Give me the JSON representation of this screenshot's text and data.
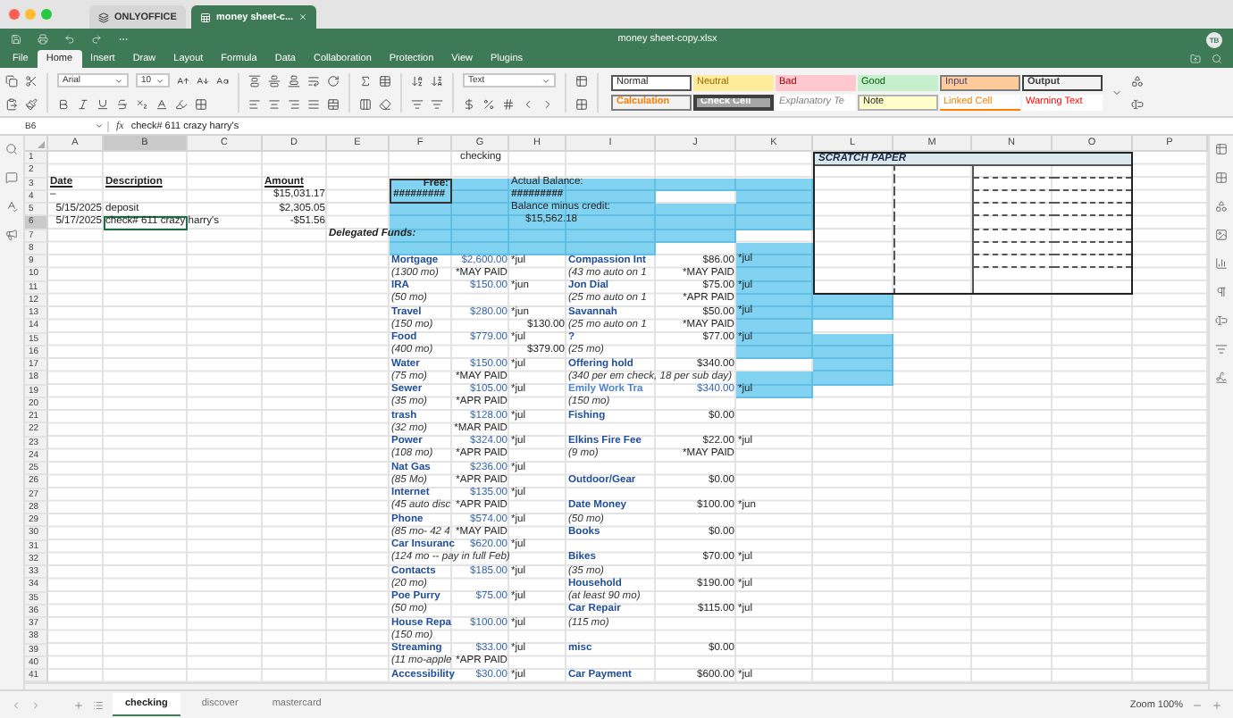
{
  "browser_tabs": [
    {
      "label": "ONLYOFFICE",
      "selected": false
    },
    {
      "label": "money sheet-c...",
      "selected": true
    }
  ],
  "title": "money sheet-copy.xlsx",
  "user_initials": "TB",
  "menu": [
    {
      "label": "File",
      "selected": false
    },
    {
      "label": "Home",
      "selected": true
    },
    {
      "label": "Insert",
      "selected": false
    },
    {
      "label": "Draw",
      "selected": false
    },
    {
      "label": "Layout",
      "selected": false
    },
    {
      "label": "Formula",
      "selected": false
    },
    {
      "label": "Data",
      "selected": false
    },
    {
      "label": "Collaboration",
      "selected": false
    },
    {
      "label": "Protection",
      "selected": false
    },
    {
      "label": "View",
      "selected": false
    },
    {
      "label": "Plugins",
      "selected": false
    }
  ],
  "toolbar": {
    "font": "Arial",
    "font_size": "10",
    "number_format": "Text",
    "styles": [
      {
        "label": "Normal",
        "kind": "normal"
      },
      {
        "label": "Neutral",
        "kind": "neutral"
      },
      {
        "label": "Bad",
        "kind": "bad"
      },
      {
        "label": "Good",
        "kind": "good"
      },
      {
        "label": "Input",
        "kind": "input"
      },
      {
        "label": "Output",
        "kind": "output"
      },
      {
        "label": "Calculation",
        "kind": "calculation"
      },
      {
        "label": "Check Cell",
        "kind": "check"
      },
      {
        "label": "Explanatory Te",
        "kind": "explanatory"
      },
      {
        "label": "Note",
        "kind": "note"
      },
      {
        "label": "Linked Cell",
        "kind": "linked"
      },
      {
        "label": "Warning Text",
        "kind": "warning"
      }
    ]
  },
  "formula_bar": {
    "cell": "B6",
    "function_label": "fx",
    "value": "check# 611 crazy harry's"
  },
  "sheet": {
    "columns": [
      {
        "label": "A",
        "selected": false
      },
      {
        "label": "B",
        "selected": true
      },
      {
        "label": "C",
        "selected": false
      },
      {
        "label": "D",
        "selected": false
      },
      {
        "label": "E",
        "selected": false
      },
      {
        "label": "F",
        "selected": false
      },
      {
        "label": "G",
        "selected": false
      },
      {
        "label": "H",
        "selected": false
      },
      {
        "label": "I",
        "selected": false
      },
      {
        "label": "J",
        "selected": false
      },
      {
        "label": "K",
        "selected": false
      },
      {
        "label": "L",
        "selected": false
      },
      {
        "label": "M",
        "selected": false
      },
      {
        "label": "N",
        "selected": false
      },
      {
        "label": "O",
        "selected": false
      },
      {
        "label": "P",
        "selected": false
      }
    ],
    "scratch_paper": {
      "title": "SCRATCH PAPER"
    },
    "rows": [
      {
        "number": "1",
        "selected": false,
        "cells": [
          {
            "fill": false
          },
          {
            "fill": false
          },
          {
            "fill": false
          },
          {
            "fill": false
          },
          {
            "fill": false
          },
          {
            "fill": false
          },
          {
            "fill": false,
            "text": "checking",
            "kind": "title"
          }
        ]
      },
      {
        "number": "2",
        "selected": false,
        "cells": []
      },
      {
        "number": "3",
        "selected": false,
        "cells": [
          {
            "fill": false,
            "text": "Date",
            "kind": "header"
          },
          {
            "fill": false,
            "text": "Description",
            "kind": "header"
          },
          {
            "fill": false
          },
          {
            "fill": false,
            "text": "Amount",
            "kind": "header"
          },
          {
            "fill": false
          },
          {
            "fill": true,
            "text": "Free:",
            "kind": "boxed_label"
          },
          {
            "fill": true
          },
          {
            "fill": true,
            "text": "Actual Balance:",
            "kind": "text"
          },
          {
            "fill": true
          },
          {
            "fill": true
          },
          {
            "fill": true
          }
        ]
      },
      {
        "number": "4",
        "selected": false,
        "cells": [
          {
            "fill": false,
            "text": "–",
            "kind": "text"
          },
          {
            "fill": false
          },
          {
            "fill": false
          },
          {
            "fill": false,
            "text": "$15,031.17",
            "kind": "amount"
          },
          {
            "fill": false
          },
          {
            "fill": true,
            "text": "#########",
            "kind": "boxed_hash"
          },
          {
            "fill": true
          },
          {
            "fill": true,
            "text": "#########",
            "kind": "hash"
          },
          {
            "fill": true
          },
          {
            "fill": false
          },
          {
            "fill": true
          }
        ]
      },
      {
        "number": "5",
        "selected": false,
        "cells": [
          {
            "fill": false,
            "text": "5/15/2025",
            "kind": "date"
          },
          {
            "fill": false,
            "text": "deposit",
            "kind": "text"
          },
          {
            "fill": false
          },
          {
            "fill": false,
            "text": "$2,305.05",
            "kind": "amount"
          },
          {
            "fill": false
          },
          {
            "fill": true
          },
          {
            "fill": true
          },
          {
            "fill": true,
            "text": "Balance minus credit:",
            "kind": "text"
          },
          {
            "fill": true
          },
          {
            "fill": true
          },
          {
            "fill": true
          }
        ]
      },
      {
        "number": "6",
        "selected": true,
        "cells": [
          {
            "fill": false,
            "text": "5/17/2025",
            "kind": "date"
          },
          {
            "fill": false,
            "text": "check# 611 crazy harry's",
            "kind": "text"
          },
          {
            "fill": false
          },
          {
            "fill": false,
            "text": "-$51.56",
            "kind": "amount"
          },
          {
            "fill": false
          },
          {
            "fill": true
          },
          {
            "fill": true
          },
          {
            "fill": true,
            "text": "$15,562.18",
            "kind": "indent"
          },
          {
            "fill": true
          },
          {
            "fill": true
          },
          {
            "fill": true
          }
        ]
      },
      {
        "number": "7",
        "selected": false,
        "cells": [
          {
            "fill": false
          },
          {
            "fill": false
          },
          {
            "fill": false
          },
          {
            "fill": false
          },
          {
            "fill": false,
            "text": "Delegated Funds:",
            "kind": "section"
          },
          {
            "fill": true
          },
          {
            "fill": true
          },
          {
            "fill": true
          },
          {
            "fill": true
          },
          {
            "fill": true
          },
          {
            "fill": false
          }
        ]
      },
      {
        "number": "8",
        "selected": false,
        "cells": [
          {
            "fill": false
          },
          {
            "fill": false
          },
          {
            "fill": false
          },
          {
            "fill": false
          },
          {
            "fill": false
          },
          {
            "fill": true
          },
          {
            "fill": true
          },
          {
            "fill": true
          },
          {
            "fill": true
          },
          {
            "fill": false
          },
          {
            "fill": true
          }
        ]
      },
      {
        "number": "9",
        "selected": false,
        "cells": [
          {
            "fill": false
          },
          {
            "fill": false
          },
          {
            "fill": false
          },
          {
            "fill": false
          },
          {
            "fill": false
          },
          {
            "fill": false,
            "text": "Mortgage",
            "kind": "name"
          },
          {
            "fill": false,
            "text": "$2,600.00",
            "kind": "money"
          },
          {
            "fill": false,
            "text": "*jul",
            "kind": "tag"
          },
          {
            "fill": false,
            "text": "Compassion Int",
            "kind": "name"
          },
          {
            "fill": false,
            "text": "$86.00",
            "kind": "amount"
          },
          {
            "fill": true,
            "text": "*jul",
            "kind": "tag"
          }
        ]
      },
      {
        "number": "10",
        "selected": false,
        "cells": [
          {
            "fill": false
          },
          {
            "fill": false
          },
          {
            "fill": false
          },
          {
            "fill": false
          },
          {
            "fill": false
          },
          {
            "fill": false,
            "text": "(1300 mo)",
            "kind": "note"
          },
          {
            "fill": false,
            "text": "*MAY PAID",
            "kind": "status"
          },
          {
            "fill": false
          },
          {
            "fill": false,
            "text": "(43 mo auto on 1",
            "kind": "note"
          },
          {
            "fill": false,
            "text": "*MAY PAID",
            "kind": "status"
          },
          {
            "fill": true
          }
        ]
      },
      {
        "number": "11",
        "selected": false,
        "cells": [
          {
            "fill": false
          },
          {
            "fill": false
          },
          {
            "fill": false
          },
          {
            "fill": false
          },
          {
            "fill": false
          },
          {
            "fill": false,
            "text": "IRA",
            "kind": "name"
          },
          {
            "fill": false,
            "text": "$150.00",
            "kind": "money"
          },
          {
            "fill": false,
            "text": "*jun",
            "kind": "tag"
          },
          {
            "fill": false,
            "text": "Jon Dial",
            "kind": "name"
          },
          {
            "fill": false,
            "text": "$75.00",
            "kind": "amount"
          },
          {
            "fill": true,
            "text": "*jul",
            "kind": "tag"
          }
        ]
      },
      {
        "number": "12",
        "selected": false,
        "cells": [
          {
            "fill": false
          },
          {
            "fill": false
          },
          {
            "fill": false
          },
          {
            "fill": false
          },
          {
            "fill": false
          },
          {
            "fill": false,
            "text": "(50 mo)",
            "kind": "note"
          },
          {
            "fill": false
          },
          {
            "fill": false
          },
          {
            "fill": false,
            "text": "(25 mo auto on 1",
            "kind": "note"
          },
          {
            "fill": false,
            "text": "*APR PAID",
            "kind": "status"
          },
          {
            "fill": true
          },
          {
            "fill": true
          }
        ]
      },
      {
        "number": "13",
        "selected": false,
        "cells": [
          {
            "fill": false
          },
          {
            "fill": false
          },
          {
            "fill": false
          },
          {
            "fill": false
          },
          {
            "fill": false
          },
          {
            "fill": false,
            "text": "Travel",
            "kind": "name"
          },
          {
            "fill": false,
            "text": "$280.00",
            "kind": "money"
          },
          {
            "fill": false,
            "text": "*jun",
            "kind": "tag"
          },
          {
            "fill": false,
            "text": "Savannah",
            "kind": "name"
          },
          {
            "fill": false,
            "text": "$50.00",
            "kind": "amount"
          },
          {
            "fill": true,
            "text": "*jul",
            "kind": "tag"
          },
          {
            "fill": true
          }
        ]
      },
      {
        "number": "14",
        "selected": false,
        "cells": [
          {
            "fill": false
          },
          {
            "fill": false
          },
          {
            "fill": false
          },
          {
            "fill": false
          },
          {
            "fill": false
          },
          {
            "fill": false,
            "text": "(150 mo)",
            "kind": "note"
          },
          {
            "fill": false
          },
          {
            "fill": false,
            "text": "$130.00",
            "kind": "amount"
          },
          {
            "fill": false,
            "text": "(25 mo auto on 1",
            "kind": "note"
          },
          {
            "fill": false,
            "text": "*MAY PAID",
            "kind": "status"
          },
          {
            "fill": true
          }
        ]
      },
      {
        "number": "15",
        "selected": false,
        "cells": [
          {
            "fill": false
          },
          {
            "fill": false
          },
          {
            "fill": false
          },
          {
            "fill": false
          },
          {
            "fill": false
          },
          {
            "fill": false,
            "text": "Food",
            "kind": "name"
          },
          {
            "fill": false,
            "text": "$779.00",
            "kind": "money"
          },
          {
            "fill": false,
            "text": "*jul",
            "kind": "tag"
          },
          {
            "fill": false,
            "text": "?",
            "kind": "name"
          },
          {
            "fill": false,
            "text": "$77.00",
            "kind": "amount"
          },
          {
            "fill": true,
            "text": "*jul",
            "kind": "tag"
          },
          {
            "fill": true
          }
        ]
      },
      {
        "number": "16",
        "selected": false,
        "cells": [
          {
            "fill": false
          },
          {
            "fill": false
          },
          {
            "fill": false
          },
          {
            "fill": false
          },
          {
            "fill": false
          },
          {
            "fill": false,
            "text": "(400 mo)",
            "kind": "note"
          },
          {
            "fill": false
          },
          {
            "fill": false,
            "text": "$379.00",
            "kind": "amount"
          },
          {
            "fill": false,
            "text": "(25 mo)",
            "kind": "note"
          },
          {
            "fill": false
          },
          {
            "fill": true
          },
          {
            "fill": true
          }
        ]
      },
      {
        "number": "17",
        "selected": false,
        "cells": [
          {
            "fill": false
          },
          {
            "fill": false
          },
          {
            "fill": false
          },
          {
            "fill": false
          },
          {
            "fill": false
          },
          {
            "fill": false,
            "text": "Water",
            "kind": "name"
          },
          {
            "fill": false,
            "text": "$150.00",
            "kind": "money"
          },
          {
            "fill": false,
            "text": "*jul",
            "kind": "tag"
          },
          {
            "fill": false,
            "text": "Offering hold",
            "kind": "name"
          },
          {
            "fill": false,
            "text": "$340.00",
            "kind": "amount"
          },
          {
            "fill": false
          },
          {
            "fill": true
          }
        ]
      },
      {
        "number": "18",
        "selected": false,
        "cells": [
          {
            "fill": false
          },
          {
            "fill": false
          },
          {
            "fill": false
          },
          {
            "fill": false
          },
          {
            "fill": false
          },
          {
            "fill": false,
            "text": "(75 mo)",
            "kind": "note"
          },
          {
            "fill": false,
            "text": "*MAY PAID",
            "kind": "status"
          },
          {
            "fill": false
          },
          {
            "fill": false,
            "text": "(340 per em check, 18 per sub day)",
            "kind": "note"
          },
          {
            "fill": false
          },
          {
            "fill": true
          },
          {
            "fill": true
          }
        ]
      },
      {
        "number": "19",
        "selected": false,
        "cells": [
          {
            "fill": false
          },
          {
            "fill": false
          },
          {
            "fill": false
          },
          {
            "fill": false
          },
          {
            "fill": false
          },
          {
            "fill": false,
            "text": "Sewer",
            "kind": "name"
          },
          {
            "fill": false,
            "text": "$105.00",
            "kind": "money"
          },
          {
            "fill": false,
            "text": "*jul",
            "kind": "tag"
          },
          {
            "fill": false,
            "text": "Emily Work Tra",
            "kind": "name_alt"
          },
          {
            "fill": false,
            "text": "$340.00",
            "kind": "money"
          },
          {
            "fill": true,
            "text": "*jul",
            "kind": "tag"
          }
        ]
      },
      {
        "number": "20",
        "selected": false,
        "cells": [
          {
            "fill": false
          },
          {
            "fill": false
          },
          {
            "fill": false
          },
          {
            "fill": false
          },
          {
            "fill": false
          },
          {
            "fill": false,
            "text": "(35 mo)",
            "kind": "note"
          },
          {
            "fill": false,
            "text": "*APR PAID",
            "kind": "status"
          },
          {
            "fill": false
          },
          {
            "fill": false,
            "text": "(150 mo)",
            "kind": "note"
          }
        ]
      },
      {
        "number": "21",
        "selected": false,
        "cells": [
          {
            "fill": false
          },
          {
            "fill": false
          },
          {
            "fill": false
          },
          {
            "fill": false
          },
          {
            "fill": false
          },
          {
            "fill": false,
            "text": "trash",
            "kind": "name"
          },
          {
            "fill": false,
            "text": "$128.00",
            "kind": "money"
          },
          {
            "fill": false,
            "text": "*jul",
            "kind": "tag"
          },
          {
            "fill": false,
            "text": "Fishing",
            "kind": "name"
          },
          {
            "fill": false,
            "text": "$0.00",
            "kind": "amount"
          }
        ]
      },
      {
        "number": "22",
        "selected": false,
        "cells": [
          {
            "fill": false
          },
          {
            "fill": false
          },
          {
            "fill": false
          },
          {
            "fill": false
          },
          {
            "fill": false
          },
          {
            "fill": false,
            "text": "(32 mo)",
            "kind": "note"
          },
          {
            "fill": false,
            "text": "*MAR PAID",
            "kind": "status"
          }
        ]
      },
      {
        "number": "23",
        "selected": false,
        "cells": [
          {
            "fill": false
          },
          {
            "fill": false
          },
          {
            "fill": false
          },
          {
            "fill": false
          },
          {
            "fill": false
          },
          {
            "fill": false,
            "text": "Power",
            "kind": "name"
          },
          {
            "fill": false,
            "text": "$324.00",
            "kind": "money"
          },
          {
            "fill": false,
            "text": "*jul",
            "kind": "tag"
          },
          {
            "fill": false,
            "text": "Elkins Fire Fee",
            "kind": "name"
          },
          {
            "fill": false,
            "text": "$22.00",
            "kind": "amount"
          },
          {
            "fill": false,
            "text": "*jul",
            "kind": "tag"
          }
        ]
      },
      {
        "number": "24",
        "selected": false,
        "cells": [
          {
            "fill": false
          },
          {
            "fill": false
          },
          {
            "fill": false
          },
          {
            "fill": false
          },
          {
            "fill": false
          },
          {
            "fill": false,
            "text": "(108 mo)",
            "kind": "note"
          },
          {
            "fill": false,
            "text": "*APR PAID",
            "kind": "status"
          },
          {
            "fill": false
          },
          {
            "fill": false,
            "text": "(9 mo)",
            "kind": "note"
          },
          {
            "fill": false,
            "text": "*MAY PAID",
            "kind": "status"
          }
        ]
      },
      {
        "number": "25",
        "selected": false,
        "cells": [
          {
            "fill": false
          },
          {
            "fill": false
          },
          {
            "fill": false
          },
          {
            "fill": false
          },
          {
            "fill": false
          },
          {
            "fill": false,
            "text": "Nat Gas",
            "kind": "name"
          },
          {
            "fill": false,
            "text": "$236.00",
            "kind": "money"
          },
          {
            "fill": false,
            "text": "*jul",
            "kind": "tag"
          }
        ]
      },
      {
        "number": "26",
        "selected": false,
        "cells": [
          {
            "fill": false
          },
          {
            "fill": false
          },
          {
            "fill": false
          },
          {
            "fill": false
          },
          {
            "fill": false
          },
          {
            "fill": false,
            "text": "(85 Mo)",
            "kind": "note"
          },
          {
            "fill": false,
            "text": "*APR PAID",
            "kind": "status"
          },
          {
            "fill": false
          },
          {
            "fill": false,
            "text": "Outdoor/Gear",
            "kind": "name"
          },
          {
            "fill": false,
            "text": "$0.00",
            "kind": "amount"
          }
        ]
      },
      {
        "number": "27",
        "selected": false,
        "cells": [
          {
            "fill": false
          },
          {
            "fill": false
          },
          {
            "fill": false
          },
          {
            "fill": false
          },
          {
            "fill": false
          },
          {
            "fill": false,
            "text": "Internet",
            "kind": "name"
          },
          {
            "fill": false,
            "text": "$135.00",
            "kind": "money"
          },
          {
            "fill": false,
            "text": "*jul",
            "kind": "tag"
          }
        ]
      },
      {
        "number": "28",
        "selected": false,
        "cells": [
          {
            "fill": false
          },
          {
            "fill": false
          },
          {
            "fill": false
          },
          {
            "fill": false
          },
          {
            "fill": false
          },
          {
            "fill": false,
            "text": "(45 auto disc",
            "kind": "note"
          },
          {
            "fill": false,
            "text": "*APR PAID",
            "kind": "status"
          },
          {
            "fill": false
          },
          {
            "fill": false,
            "text": "Date Money",
            "kind": "name"
          },
          {
            "fill": false,
            "text": "$100.00",
            "kind": "amount"
          },
          {
            "fill": false,
            "text": "*jun",
            "kind": "tag"
          }
        ]
      },
      {
        "number": "29",
        "selected": false,
        "cells": [
          {
            "fill": false
          },
          {
            "fill": false
          },
          {
            "fill": false
          },
          {
            "fill": false
          },
          {
            "fill": false
          },
          {
            "fill": false,
            "text": "Phone",
            "kind": "name"
          },
          {
            "fill": false,
            "text": "$574.00",
            "kind": "money"
          },
          {
            "fill": false,
            "text": "*jul",
            "kind": "tag"
          },
          {
            "fill": false,
            "text": "(50 mo)",
            "kind": "note"
          }
        ]
      },
      {
        "number": "30",
        "selected": false,
        "cells": [
          {
            "fill": false
          },
          {
            "fill": false
          },
          {
            "fill": false
          },
          {
            "fill": false
          },
          {
            "fill": false
          },
          {
            "fill": false,
            "text": "(85 mo- 42 4",
            "kind": "note"
          },
          {
            "fill": false,
            "text": "*MAY PAID",
            "kind": "status"
          },
          {
            "fill": false
          },
          {
            "fill": false,
            "text": "Books",
            "kind": "name"
          },
          {
            "fill": false,
            "text": "$0.00",
            "kind": "amount"
          }
        ]
      },
      {
        "number": "31",
        "selected": false,
        "cells": [
          {
            "fill": false
          },
          {
            "fill": false
          },
          {
            "fill": false
          },
          {
            "fill": false
          },
          {
            "fill": false
          },
          {
            "fill": false,
            "text": "Car Insuranc",
            "kind": "name"
          },
          {
            "fill": false,
            "text": "$620.00",
            "kind": "money"
          },
          {
            "fill": false,
            "text": "*jul",
            "kind": "tag"
          }
        ]
      },
      {
        "number": "32",
        "selected": false,
        "cells": [
          {
            "fill": false
          },
          {
            "fill": false
          },
          {
            "fill": false
          },
          {
            "fill": false
          },
          {
            "fill": false
          },
          {
            "fill": false,
            "text": "(124 mo -- pay in full Feb)",
            "kind": "note"
          },
          {
            "fill": false
          },
          {
            "fill": false
          },
          {
            "fill": false,
            "text": "Bikes",
            "kind": "name"
          },
          {
            "fill": false,
            "text": "$70.00",
            "kind": "amount"
          },
          {
            "fill": false,
            "text": "*jul",
            "kind": "tag"
          }
        ]
      },
      {
        "number": "33",
        "selected": false,
        "cells": [
          {
            "fill": false
          },
          {
            "fill": false
          },
          {
            "fill": false
          },
          {
            "fill": false
          },
          {
            "fill": false
          },
          {
            "fill": false,
            "text": "Contacts",
            "kind": "name"
          },
          {
            "fill": false,
            "text": "$185.00",
            "kind": "money"
          },
          {
            "fill": false,
            "text": "*jul",
            "kind": "tag"
          },
          {
            "fill": false,
            "text": "(35 mo)",
            "kind": "note"
          }
        ]
      },
      {
        "number": "34",
        "selected": false,
        "cells": [
          {
            "fill": false
          },
          {
            "fill": false
          },
          {
            "fill": false
          },
          {
            "fill": false
          },
          {
            "fill": false
          },
          {
            "fill": false,
            "text": "(20 mo)",
            "kind": "note"
          },
          {
            "fill": false
          },
          {
            "fill": false
          },
          {
            "fill": false,
            "text": "Household",
            "kind": "name"
          },
          {
            "fill": false,
            "text": "$190.00",
            "kind": "amount"
          },
          {
            "fill": false,
            "text": "*jul",
            "kind": "tag"
          }
        ]
      },
      {
        "number": "35",
        "selected": false,
        "cells": [
          {
            "fill": false
          },
          {
            "fill": false
          },
          {
            "fill": false
          },
          {
            "fill": false
          },
          {
            "fill": false
          },
          {
            "fill": false,
            "text": "Poe Purry",
            "kind": "name"
          },
          {
            "fill": false,
            "text": "$75.00",
            "kind": "money"
          },
          {
            "fill": false,
            "text": "*jul",
            "kind": "tag"
          },
          {
            "fill": false,
            "text": "(at least 90 mo)",
            "kind": "note"
          }
        ]
      },
      {
        "number": "36",
        "selected": false,
        "cells": [
          {
            "fill": false
          },
          {
            "fill": false
          },
          {
            "fill": false
          },
          {
            "fill": false
          },
          {
            "fill": false
          },
          {
            "fill": false,
            "text": "(50 mo)",
            "kind": "note"
          },
          {
            "fill": false
          },
          {
            "fill": false
          },
          {
            "fill": false,
            "text": "Car Repair",
            "kind": "name"
          },
          {
            "fill": false,
            "text": "$115.00",
            "kind": "amount"
          },
          {
            "fill": false,
            "text": "*jul",
            "kind": "tag"
          }
        ]
      },
      {
        "number": "37",
        "selected": false,
        "cells": [
          {
            "fill": false
          },
          {
            "fill": false
          },
          {
            "fill": false
          },
          {
            "fill": false
          },
          {
            "fill": false
          },
          {
            "fill": false,
            "text": "House Repa",
            "kind": "name"
          },
          {
            "fill": false,
            "text": "$100.00",
            "kind": "money"
          },
          {
            "fill": false,
            "text": "*jul",
            "kind": "tag"
          },
          {
            "fill": false,
            "text": "(115 mo)",
            "kind": "note"
          }
        ]
      },
      {
        "number": "38",
        "selected": false,
        "cells": [
          {
            "fill": false
          },
          {
            "fill": false
          },
          {
            "fill": false
          },
          {
            "fill": false
          },
          {
            "fill": false
          },
          {
            "fill": false,
            "text": "(150 mo)",
            "kind": "note"
          }
        ]
      },
      {
        "number": "39",
        "selected": false,
        "cells": [
          {
            "fill": false
          },
          {
            "fill": false
          },
          {
            "fill": false
          },
          {
            "fill": false
          },
          {
            "fill": false
          },
          {
            "fill": false,
            "text": "Streaming",
            "kind": "name"
          },
          {
            "fill": false,
            "text": "$33.00",
            "kind": "money"
          },
          {
            "fill": false,
            "text": "*jul",
            "kind": "tag"
          },
          {
            "fill": false,
            "text": "misc",
            "kind": "name"
          },
          {
            "fill": false,
            "text": "$0.00",
            "kind": "amount"
          }
        ]
      },
      {
        "number": "40",
        "selected": false,
        "cells": [
          {
            "fill": false
          },
          {
            "fill": false
          },
          {
            "fill": false
          },
          {
            "fill": false
          },
          {
            "fill": false
          },
          {
            "fill": false,
            "text": "(11 mo-apple",
            "kind": "note"
          },
          {
            "fill": false,
            "text": "*APR PAID",
            "kind": "status"
          }
        ]
      },
      {
        "number": "41",
        "selected": false,
        "cells": [
          {
            "fill": false
          },
          {
            "fill": false
          },
          {
            "fill": false
          },
          {
            "fill": false
          },
          {
            "fill": false
          },
          {
            "fill": false,
            "text": "Accessibility",
            "kind": "name"
          },
          {
            "fill": false,
            "text": "$30.00",
            "kind": "money"
          },
          {
            "fill": false,
            "text": "*jul",
            "kind": "tag"
          },
          {
            "fill": false,
            "text": "Car Payment",
            "kind": "name"
          },
          {
            "fill": false,
            "text": "$600.00",
            "kind": "amount"
          },
          {
            "fill": false,
            "text": "*jul",
            "kind": "tag"
          }
        ]
      }
    ]
  },
  "sheet_tabs": [
    {
      "label": "checking",
      "selected": true
    },
    {
      "label": "discover",
      "selected": false
    },
    {
      "label": "mastercard",
      "selected": false
    }
  ],
  "zoom": "Zoom 100%"
}
